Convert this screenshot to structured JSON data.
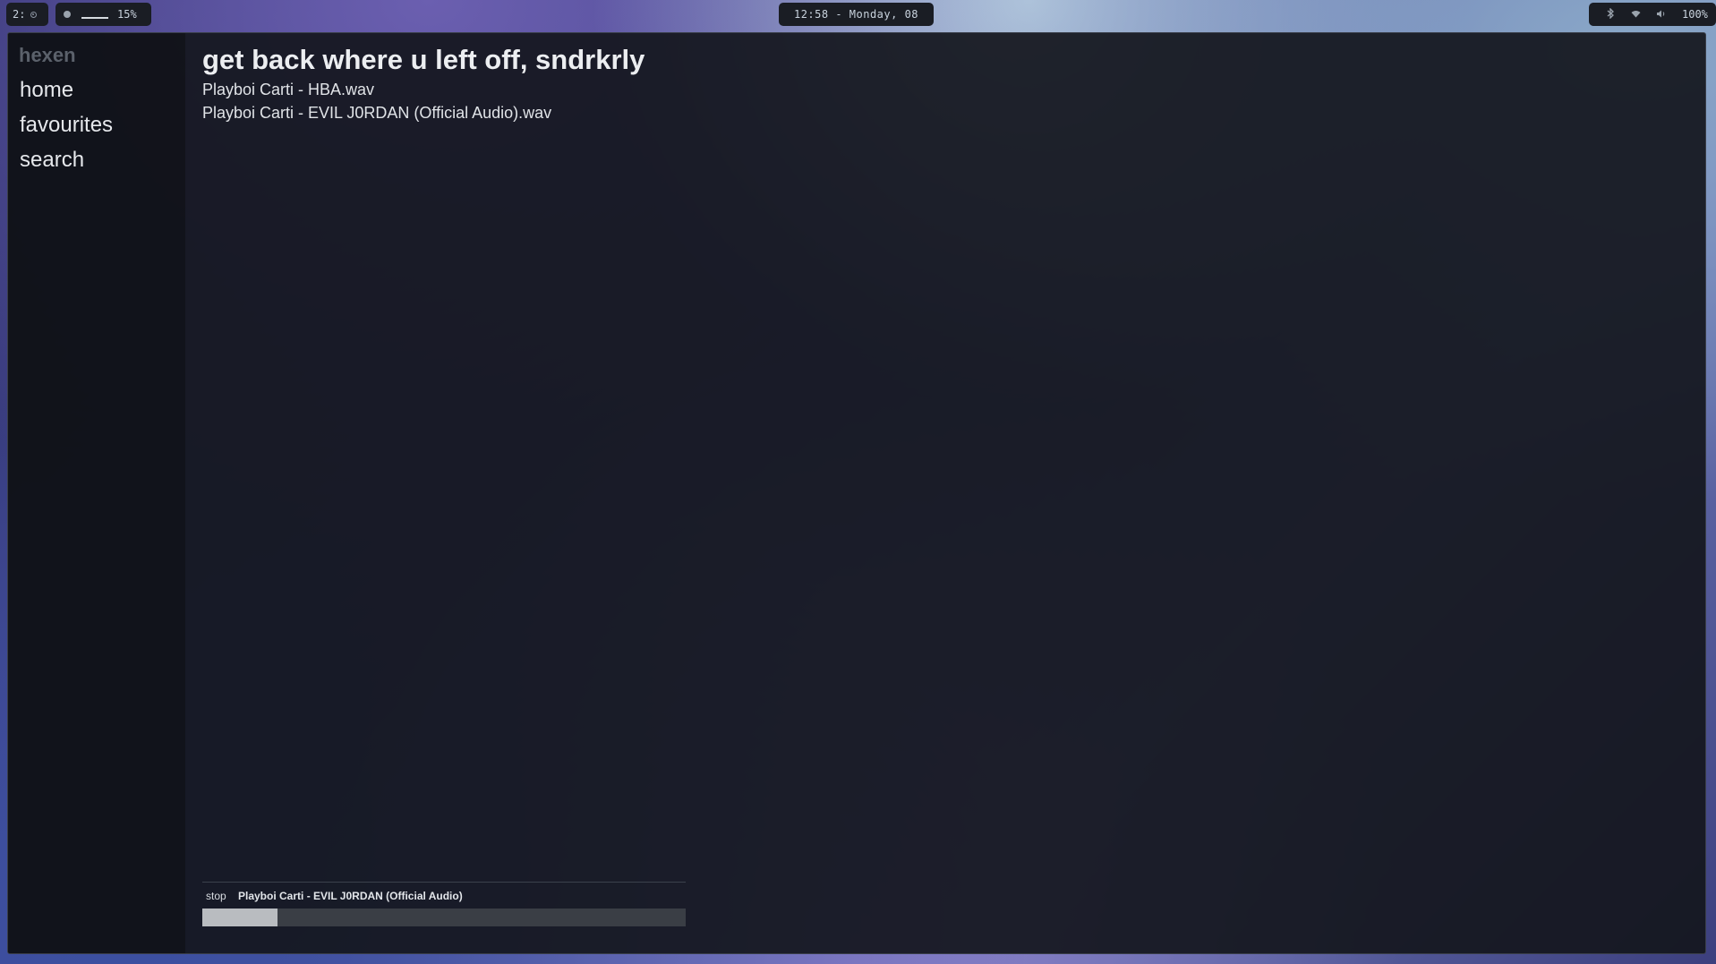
{
  "topbar": {
    "workspace": "2:",
    "brightness": "15%",
    "clock": "12:58 -  Monday, 08",
    "battery": "100%",
    "icons": [
      "record-icon",
      "brightness-icon",
      "bluetooth-icon",
      "wifi-icon",
      "volume-icon"
    ]
  },
  "app": {
    "name": "hexen",
    "nav": [
      "home",
      "favourites",
      "search"
    ]
  },
  "main": {
    "title": "get back where u left off, sndrkrly",
    "tracks": [
      "Playboi Carti - HBA.wav",
      "Playboi Carti - EVIL J0RDAN (Official Audio).wav"
    ]
  },
  "player": {
    "stop_label": "stop",
    "now_playing": "Playboi Carti - EVIL J0RDAN (Official Audio)",
    "progress": 0.156
  },
  "colors": {
    "window_bg": "#14171e",
    "text": "#e6e8ec",
    "brand": "#5b616b",
    "progress_fill": "#b9bcc0",
    "progress_track": "#3a3e45"
  }
}
